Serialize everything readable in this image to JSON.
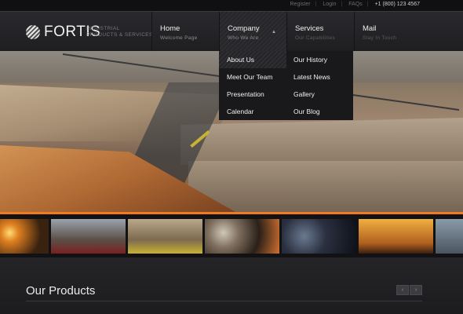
{
  "topbar": {
    "register": "Register",
    "login": "Login",
    "faqs": "FAQs",
    "phone": "+1 (800) 123 4567"
  },
  "brand": {
    "name": "FORTIS",
    "tagline_line1": "INDUSTRIAL",
    "tagline_line2": "PRODUCTS & SERVICES"
  },
  "nav": [
    {
      "title": "Home",
      "subtitle": "Welcome Page"
    },
    {
      "title": "Company",
      "subtitle": "Who We Are"
    },
    {
      "title": "Services",
      "subtitle": "Our Capabilities"
    },
    {
      "title": "Mail",
      "subtitle": "Stay In Touch"
    }
  ],
  "dropdown": {
    "company": [
      "About Us",
      "Meet Our Team",
      "Presentation",
      "Calendar"
    ],
    "services": [
      "Our History",
      "Latest News",
      "Gallery",
      "Our Blog"
    ]
  },
  "products": {
    "title": "Our Products",
    "prev": "‹",
    "next": "›"
  },
  "colors": {
    "accent": "#f07a1e",
    "background": "#1b1b1d"
  },
  "thumbnails": [
    "welding sparks",
    "heavy machinery",
    "construction site",
    "grinding disc",
    "worker portrait",
    "engineers at sunset",
    "industrial"
  ]
}
